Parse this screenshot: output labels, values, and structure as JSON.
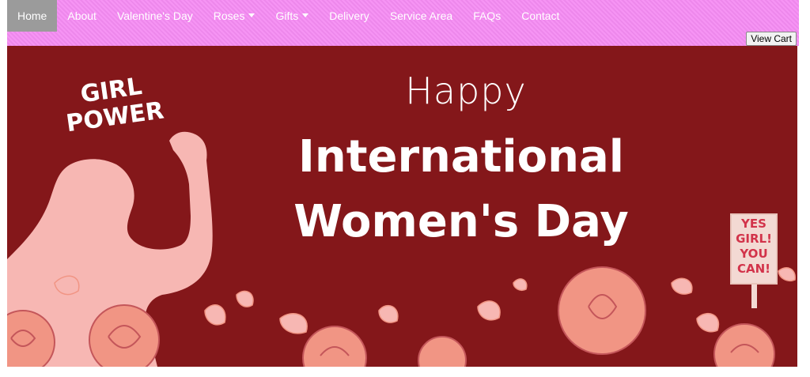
{
  "nav": {
    "items": [
      {
        "label": "Home",
        "active": true
      },
      {
        "label": "About"
      },
      {
        "label": "Valentine's Day"
      },
      {
        "label": "Roses",
        "dropdown": true
      },
      {
        "label": "Gifts",
        "dropdown": true
      },
      {
        "label": "Delivery"
      },
      {
        "label": "Service Area"
      },
      {
        "label": "FAQs"
      },
      {
        "label": "Contact"
      }
    ],
    "cart_label": "View Cart"
  },
  "banner": {
    "happy": "Happy",
    "line1": "International",
    "line2": "Women's Day",
    "girl_power_1": "GIRL",
    "girl_power_2": "POWER",
    "sign_1": "YES",
    "sign_2": "GIRL!",
    "sign_3": "YOU",
    "sign_4": "CAN!"
  },
  "colors": {
    "nav_bg": "#f58cf3",
    "active_bg": "#9b9b9b",
    "banner_bg": "#84171a",
    "rose": "#f19584",
    "silhouette": "#f7b7b3"
  }
}
